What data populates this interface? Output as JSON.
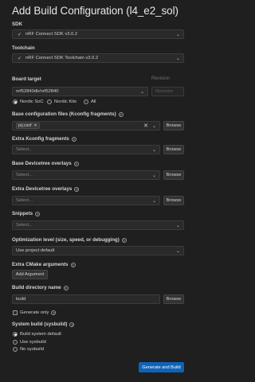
{
  "title": "Add Build Configuration (l4_e2_sol)",
  "sdk": {
    "label": "SDK",
    "value": "nRF Connect SDK v3.0.2"
  },
  "toolchain": {
    "label": "Toolchain",
    "value": "nRF Connect SDK Toolchain v3.0.2"
  },
  "board_target": {
    "label": "Board target",
    "value": "nrf52840dk/nrf52840",
    "revision_label": "Revision",
    "revision_placeholder": "Revision",
    "filters": [
      {
        "label": "Nordic SoC",
        "selected": true
      },
      {
        "label": "Nordic Kits",
        "selected": false
      },
      {
        "label": "All",
        "selected": false
      }
    ]
  },
  "base_config": {
    "label": "Base configuration files (Kconfig fragments)",
    "tag": "prj.conf",
    "browse": "Browse"
  },
  "extra_kconfig": {
    "label": "Extra Kconfig fragments",
    "placeholder": "Select...",
    "browse": "Browse"
  },
  "base_devicetree": {
    "label": "Base Devicetree overlays",
    "placeholder": "Select...",
    "browse": "Browse"
  },
  "extra_devicetree": {
    "label": "Extra Devicetree overlays",
    "placeholder": "Select...",
    "browse": "Browse"
  },
  "snippets": {
    "label": "Snippets",
    "placeholder": "Select..."
  },
  "optimization": {
    "label": "Optimization level (size, speed, or debugging)",
    "value": "Use project default"
  },
  "extra_cmake": {
    "label": "Extra CMake arguments",
    "button": "Add Argument"
  },
  "build_dir": {
    "label": "Build directory name",
    "value": "build",
    "browse": "Browse"
  },
  "generate_only": {
    "label": "Generate only",
    "checked": false
  },
  "system_build": {
    "label": "System build (sysbuild)",
    "options": [
      {
        "label": "Build system default",
        "selected": true
      },
      {
        "label": "Use sysbuild",
        "selected": false
      },
      {
        "label": "No sysbuild",
        "selected": false
      }
    ]
  },
  "submit": "Generate and Build"
}
